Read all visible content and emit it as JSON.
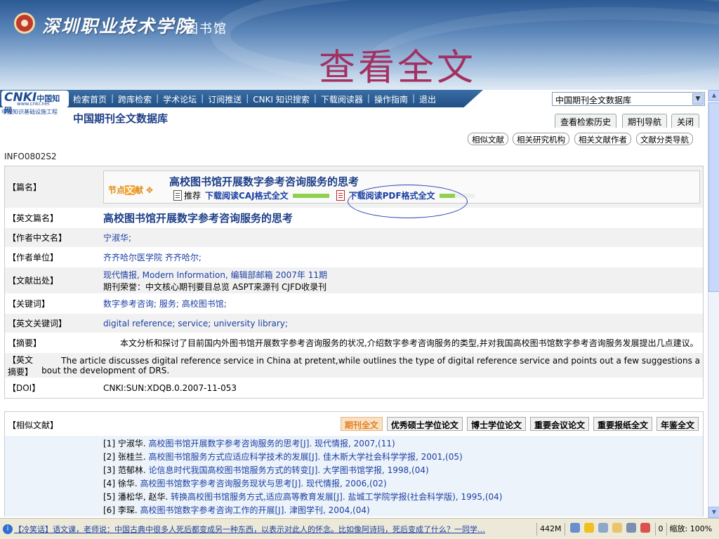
{
  "banner": {
    "school_name": "深圳职业技术学院",
    "library_name": "图书馆",
    "slide_title": "查看全文"
  },
  "cnki": {
    "logo_text": "CNKI",
    "logo_cn": "中国知网",
    "logo_url": "www.cnki.net",
    "sub": "中国知识基础设施工程",
    "nav_links": [
      "检索首页",
      "跨库检索",
      "学术论坛",
      "订阅推送",
      "CNKI 知识搜索",
      "下载阅读器",
      "操作指南",
      "退出"
    ],
    "db_title": "中国期刊全文数据库",
    "db_select": "中国期刊全文数据库",
    "tabs": [
      "查看检索历史",
      "期刊导航",
      "关闭"
    ],
    "pills": [
      "相似文献",
      "相关研究机构",
      "相关文献作者",
      "文献分类导航"
    ]
  },
  "info_id": "INFO0802S2",
  "detail": {
    "title_label": "【篇名】",
    "jiedian": {
      "a": "节点",
      "b": "文",
      "c": "献"
    },
    "article_title": "高校图书馆开展数字参考咨询服务的思考",
    "recommend": "推荐",
    "caj_link": "下载阅读CAJ格式全文",
    "pdf_link": "下载阅读PDF格式全文",
    "caj_bar_fraction": 1.0,
    "pdf_bar_fraction": 0.45,
    "rows": [
      {
        "label": "【英文篇名】",
        "value": "高校图书馆开展数字参考咨询服务的思考"
      },
      {
        "label": "【作者中文名】",
        "value": "宁淑华;"
      },
      {
        "label": "【作者单位】",
        "value": "齐齐哈尔医学院  齐齐哈尔;"
      },
      {
        "label": "【文献出处】",
        "value": "现代情报, Modern Information, 编辑部邮箱  2007年  11期",
        "value2": "期刊荣誉：中文核心期刊要目总览  ASPT来源刊  CJFD收录刊"
      },
      {
        "label": "【关键词】",
        "value": "数字参考咨询; 服务; 高校图书馆;"
      },
      {
        "label": "【英文关键词】",
        "value": "digital reference; service; university library;"
      },
      {
        "label": "【摘要】",
        "value": "本文分析和探讨了目前国内外图书馆开展数字参考咨询服务的状况,介绍数字参考咨询服务的类型,并对我国高校图书馆数字参考咨询服务发展提出几点建议。"
      },
      {
        "label": "【英文摘要】",
        "value": "The article discusses digital reference service in China at pretent,while outlines the type of digital reference service and points out a few suggestions a",
        "value2": "bout the development of DRS."
      },
      {
        "label": "【DOI】",
        "value": "CNKI:SUN:XDQB.0.2007-11-053"
      }
    ]
  },
  "related": {
    "label": "【相似文献】",
    "tabs": [
      "期刊全文",
      "优秀硕士学位论文",
      "博士学位论文",
      "重要会议论文",
      "重要报纸全文",
      "年鉴全文"
    ],
    "items": [
      {
        "n": "[1]",
        "author": "宁淑华.",
        "title": "高校图书馆开展数字参考咨询服务的思考[J].",
        "journal": "现代情报",
        "date": ", 2007,(11)"
      },
      {
        "n": "[2]",
        "author": "张桂兰.",
        "title": "高校图书馆服务方式应适应科学技术的发展[J].",
        "journal": "佳木斯大学社会科学学报",
        "date": ", 2001,(05)"
      },
      {
        "n": "[3]",
        "author": "范郁林.",
        "title": "论信息时代我国高校图书馆服务方式的转变[J].",
        "journal": "大学图书馆学报",
        "date": ", 1998,(04)"
      },
      {
        "n": "[4]",
        "author": "徐华.",
        "title": "高校图书馆数字参考咨询服务现状与思考[J].",
        "journal": "现代情报",
        "date": ", 2006,(02)"
      },
      {
        "n": "[5]",
        "author": "潘松华, 赵华.",
        "title": "转换高校图书馆服务方式,适应高等教育发展[J].",
        "journal": "盐城工学院学报(社会科学版)",
        "date": ", 1995,(04)"
      },
      {
        "n": "[6]",
        "author": "李琛.",
        "title": "高校图书馆数字参考咨询工作的开展[J].",
        "journal": "津图学刊",
        "date": ", 2004,(04)"
      }
    ]
  },
  "statusbar": {
    "ad": "【冷笑话】语文课，老师说：中国古典中很多人死后都变成另一种东西，以表示对此人的怀念。比如像阿诗玛，死后变成了什么？一同学…",
    "mem": "442M",
    "count": "0",
    "zoom": "缩放: 100%"
  },
  "colors": {
    "banner": "#5b86b9",
    "slide_title": "#a23060",
    "link": "#1a3fa3",
    "nav": "#1f4f85",
    "active_tab": "#e67e1a"
  },
  "icons": [
    "seal-icon",
    "doc-icon",
    "pdf-icon",
    "scroll-up-icon",
    "scroll-down-icon",
    "info-icon"
  ]
}
